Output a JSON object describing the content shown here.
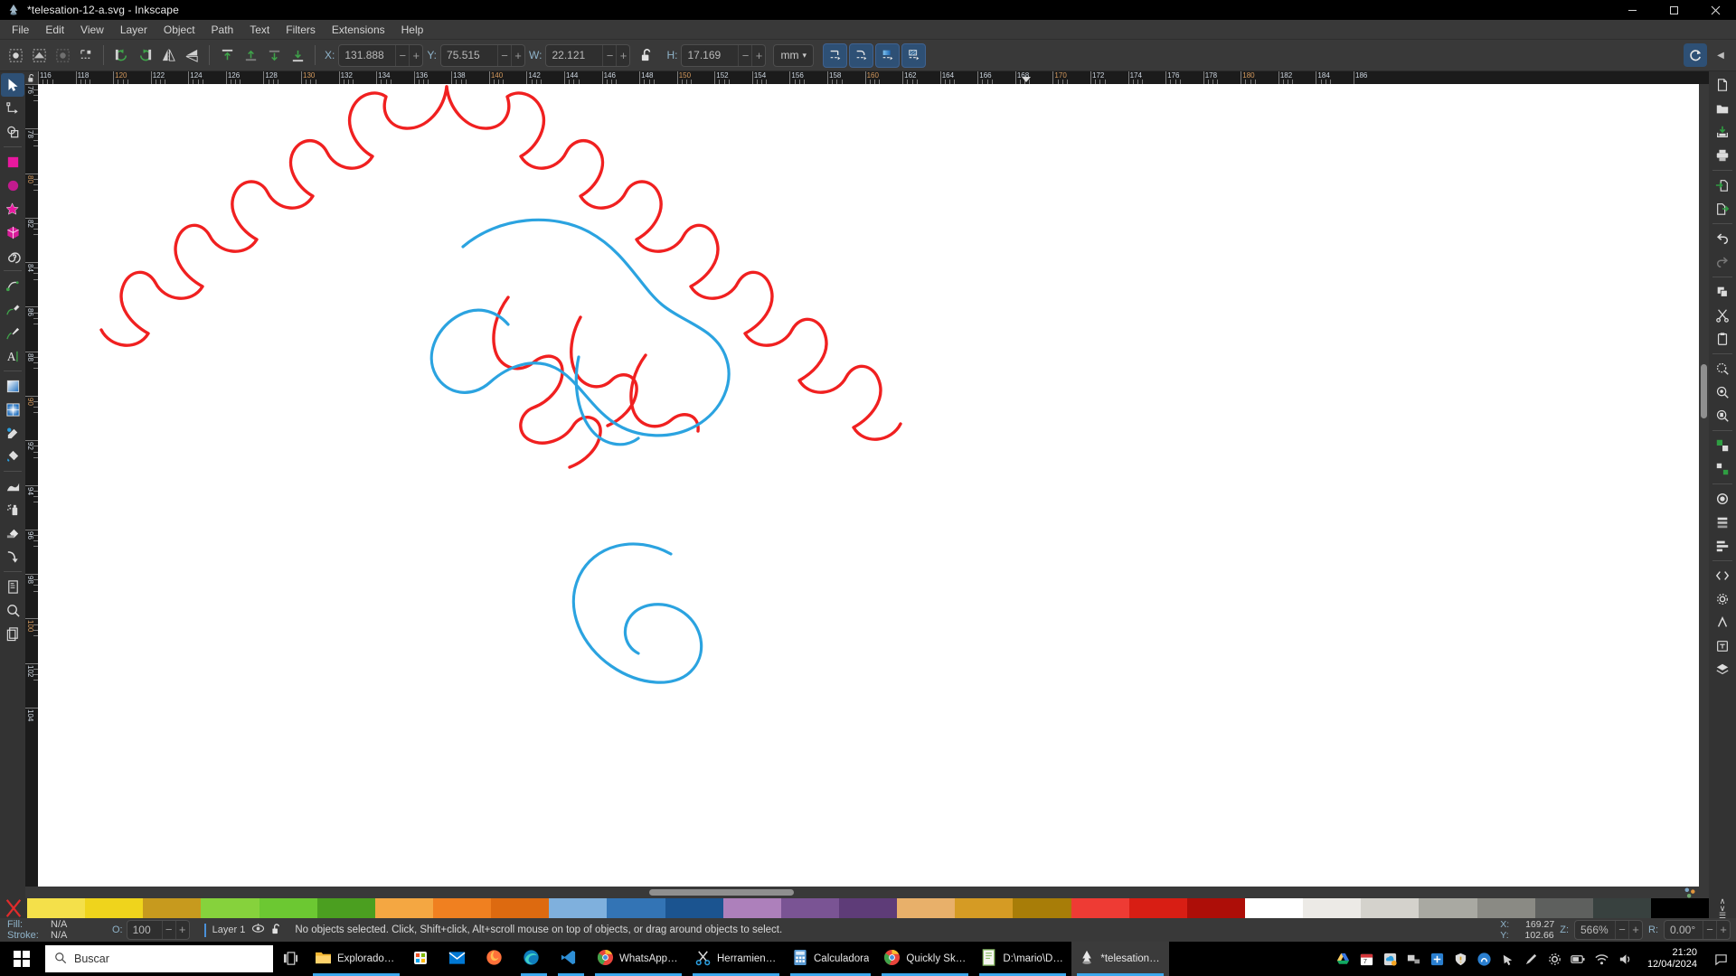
{
  "window": {
    "title": "*telesation-12-a.svg - Inkscape",
    "app_icon": "inkscape-logo-icon",
    "minimize_label": "–",
    "maximize_label": "❐",
    "close_label": "✕"
  },
  "menubar": {
    "items": [
      {
        "label": "File"
      },
      {
        "label": "Edit"
      },
      {
        "label": "View"
      },
      {
        "label": "Layer"
      },
      {
        "label": "Object"
      },
      {
        "label": "Path"
      },
      {
        "label": "Text"
      },
      {
        "label": "Filters"
      },
      {
        "label": "Extensions"
      },
      {
        "label": "Help"
      }
    ]
  },
  "toolbar": {
    "select_all_icon": "select-all-icon",
    "select_all_layers_icon": "select-all-in-layers-icon",
    "deselect_icon": "deselect-icon",
    "toggle_selection_icon": "toggle-selection-box-icon",
    "rotate_ccw_icon": "rotate-90-ccw-icon",
    "rotate_cw_icon": "rotate-90-cw-icon",
    "flip_h_icon": "flip-horizontal-icon",
    "flip_v_icon": "flip-vertical-icon",
    "raise_to_top_icon": "raise-to-top-icon",
    "raise_icon": "raise-icon",
    "lower_icon": "lower-icon",
    "lower_to_bottom_icon": "lower-to-bottom-icon",
    "x_label": "X:",
    "x_value": "131.888",
    "y_label": "Y:",
    "y_value": "75.515",
    "w_label": "W:",
    "w_value": "22.121",
    "h_label": "H:",
    "h_value": "17.169",
    "lock_icon": "unlocked-padlock-icon",
    "unit_value": "mm",
    "unit_caret": "▾",
    "minus": "−",
    "plus": "+",
    "affect_stroke_icon": "scale-stroke-width-icon",
    "affect_corners_icon": "scale-rounded-corners-icon",
    "affect_gradients_icon": "move-gradients-icon",
    "affect_patterns_icon": "move-patterns-icon",
    "rotation_lock_icon": "rotation-handles-icon",
    "collapse_icon": "◀"
  },
  "toolstrip": {
    "tools": [
      {
        "name": "selector-tool",
        "icon": "arrow-cursor-icon",
        "active": true
      },
      {
        "name": "node-tool",
        "icon": "node-editor-icon",
        "active": false
      },
      {
        "name": "shape-builder-tool",
        "icon": "shape-builder-icon",
        "active": false
      },
      {
        "name": "rectangle-tool",
        "icon": "rectangle-icon",
        "active": false
      },
      {
        "name": "ellipse-tool",
        "icon": "ellipse-icon",
        "active": false
      },
      {
        "name": "star-tool",
        "icon": "star-icon",
        "active": false
      },
      {
        "name": "box3d-tool",
        "icon": "3d-box-icon",
        "active": false
      },
      {
        "name": "spiral-tool",
        "icon": "spiral-icon",
        "active": false
      },
      {
        "name": "pencil-tool",
        "icon": "pencil-icon",
        "active": false
      },
      {
        "name": "bezier-tool",
        "icon": "bezier-pen-icon",
        "active": false
      },
      {
        "name": "calligraphy-tool",
        "icon": "calligraphy-brush-icon",
        "active": false
      },
      {
        "name": "text-tool",
        "icon": "text-a-icon",
        "active": false
      },
      {
        "name": "gradient-tool",
        "icon": "gradient-square-icon",
        "active": false
      },
      {
        "name": "mesh-tool",
        "icon": "mesh-gradient-icon",
        "active": false
      },
      {
        "name": "dropper-tool",
        "icon": "eyedropper-icon",
        "active": false
      },
      {
        "name": "paintbucket-tool",
        "icon": "paint-bucket-icon",
        "active": false
      },
      {
        "name": "tweak-tool",
        "icon": "tweak-icon",
        "active": false
      },
      {
        "name": "spray-tool",
        "icon": "spray-can-icon",
        "active": false
      },
      {
        "name": "eraser-tool",
        "icon": "eraser-icon",
        "active": false
      },
      {
        "name": "connector-tool",
        "icon": "connector-icon",
        "active": false
      },
      {
        "name": "pages-tool",
        "icon": "page-icon",
        "active": false
      },
      {
        "name": "zoom-tool",
        "icon": "magnifier-icon",
        "active": false
      },
      {
        "name": "measure-tool",
        "icon": "measure-copies-icon",
        "active": false
      }
    ]
  },
  "cmdstrip": {
    "buttons": [
      {
        "name": "new-document",
        "icon": "new-document-icon"
      },
      {
        "name": "open-document",
        "icon": "open-folder-icon"
      },
      {
        "name": "save-document",
        "icon": "save-icon"
      },
      {
        "name": "print-document",
        "icon": "printer-icon"
      },
      {
        "name": "import",
        "icon": "import-icon"
      },
      {
        "name": "export",
        "icon": "export-icon"
      },
      {
        "name": "undo",
        "icon": "undo-arrow-icon"
      },
      {
        "name": "redo",
        "icon": "redo-arrow-icon"
      },
      {
        "name": "duplicate",
        "icon": "duplicate-icon"
      },
      {
        "name": "cut",
        "icon": "scissors-icon"
      },
      {
        "name": "paste",
        "icon": "clipboard-icon"
      },
      {
        "name": "zoom-selection",
        "icon": "zoom-selection-icon"
      },
      {
        "name": "zoom-drawing",
        "icon": "zoom-drawing-icon"
      },
      {
        "name": "zoom-page",
        "icon": "zoom-page-icon"
      },
      {
        "name": "group",
        "icon": "group-objects-icon"
      },
      {
        "name": "ungroup",
        "icon": "ungroup-objects-icon"
      },
      {
        "name": "fill-stroke-dialog",
        "icon": "fill-stroke-icon"
      },
      {
        "name": "objects-dialog",
        "icon": "objects-list-icon"
      },
      {
        "name": "align-dialog",
        "icon": "align-distribute-icon"
      },
      {
        "name": "xml-editor",
        "icon": "xml-editor-icon"
      },
      {
        "name": "preferences",
        "icon": "preferences-gear-icon"
      },
      {
        "name": "symbols-dialog",
        "icon": "symbols-icon"
      },
      {
        "name": "text-dialog",
        "icon": "text-properties-icon"
      },
      {
        "name": "layers-dialog",
        "icon": "layers-icon"
      }
    ]
  },
  "rulers": {
    "h_start": 116,
    "h_end": 186,
    "h_step": 2,
    "v_start": 76,
    "v_end": 104,
    "v_step": 2,
    "cursor_marker_h": 168.6
  },
  "canvas": {
    "document_label": "canvas-drawing-area",
    "red_path_color": "#f02020",
    "blue_path_color": "#2ba3e0"
  },
  "palette": {
    "none_icon": "no-color-x-icon",
    "colors": [
      "#f4e04a",
      "#efd41c",
      "#c79a1e",
      "#86d23c",
      "#6cc832",
      "#4b9f20",
      "#f4a742",
      "#f08020",
      "#dd6a10",
      "#7fb0dd",
      "#3374b5",
      "#1b5490",
      "#ad80bb",
      "#7a5494",
      "#5e3c78",
      "#e8b06a",
      "#d59b24",
      "#a87d08",
      "#ee3b34",
      "#d81e14",
      "#ad0e08",
      "#ffffff",
      "#eceae6",
      "#d4d2cc",
      "#a9a9a2",
      "#8a8a84",
      "#5e605e",
      "#38413f",
      "#000000"
    ],
    "scroll_up_icon": "∧",
    "scroll_down_icon": "∨",
    "menu_icon": "☰"
  },
  "statusbar": {
    "fill_label": "Fill:",
    "fill_value": "N/A",
    "stroke_label": "Stroke:",
    "stroke_value": "N/A",
    "opacity_label": "O:",
    "opacity_value": "100",
    "minus": "−",
    "plus": "+",
    "layer_name": "Layer 1",
    "layer_visible_icon": "eye-icon",
    "layer_lock_icon": "unlocked-padlock-icon",
    "message": "No objects selected. Click, Shift+click, Alt+scroll mouse on top of objects, or drag around objects to select.",
    "x_label": "X:",
    "x_value": "169.27",
    "y_label": "Y:",
    "y_value": "102.66",
    "zoom_label": "Z:",
    "zoom_value": "566%",
    "rotation_label": "R:",
    "rotation_value": "0.00°"
  },
  "taskbar": {
    "start_icon": "windows-start-icon",
    "search_icon": "search-magnifier-icon",
    "search_placeholder": "Buscar",
    "taskview_icon": "task-view-icon",
    "items": [
      {
        "label": "Explorador d...",
        "icon": "file-explorer-icon",
        "running": true,
        "active": false
      },
      {
        "label": "",
        "icon": "microsoft-store-icon",
        "running": false,
        "active": false
      },
      {
        "label": "",
        "icon": "mail-icon",
        "running": false,
        "active": false
      },
      {
        "label": "",
        "icon": "firefox-icon",
        "running": false,
        "active": false
      },
      {
        "label": "",
        "icon": "edge-icon",
        "running": true,
        "active": false
      },
      {
        "label": "",
        "icon": "vscode-icon",
        "running": true,
        "active": false
      },
      {
        "label": "WhatsApp - ...",
        "icon": "chrome-icon",
        "running": true,
        "active": false
      },
      {
        "label": "Herramienta ...",
        "icon": "snipping-tool-icon",
        "running": true,
        "active": false
      },
      {
        "label": "Calculadora",
        "icon": "calculator-icon",
        "running": true,
        "active": false
      },
      {
        "label": "Quickly Sket...",
        "icon": "chrome-icon",
        "running": true,
        "active": false
      },
      {
        "label": "D:\\mario\\Do...",
        "icon": "notepad-icon",
        "running": true,
        "active": false
      },
      {
        "label": "*telesation-1...",
        "icon": "inkscape-logo-icon",
        "running": true,
        "active": true
      }
    ],
    "tray_icons": [
      "google-drive-icon",
      "calendar-icon",
      "onedrive-icon",
      "display-icon",
      "blue-app-icon",
      "security-shield-icon",
      "teams-icon",
      "mouse-icon",
      "pen-icon",
      "settings-icon",
      "battery-icon",
      "wifi-icon",
      "volume-icon"
    ],
    "clock_time": "21:20",
    "clock_date": "12/04/2024",
    "notification_icon": "notification-bell-icon"
  }
}
